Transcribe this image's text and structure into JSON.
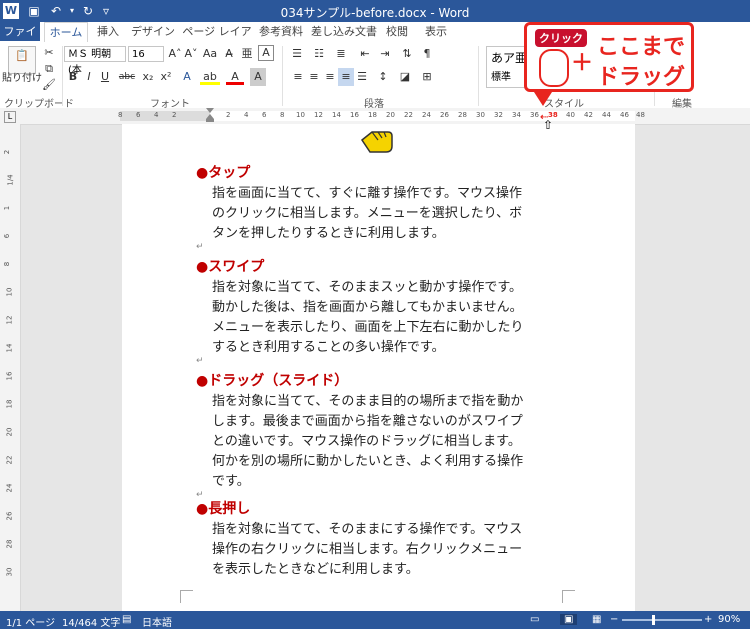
{
  "window": {
    "title": "034サンプル-before.docx - Word"
  },
  "tabs": [
    "ファイル",
    "ホーム",
    "挿入",
    "デザイン",
    "ページ レイアウト",
    "参考資料",
    "差し込み文書",
    "校閲",
    "表示"
  ],
  "ribbon": {
    "paste_label": "貼り付け",
    "font_name": "ＭＳ 明朝 (本",
    "font_size": "16",
    "style_preview": "あア亜",
    "style_name": "標準",
    "groups": {
      "clipboard": "クリップボード",
      "font": "フォント",
      "paragraph": "段落",
      "styles": "スタイル",
      "editing": "編集"
    },
    "format_buttons": [
      "B",
      "I",
      "U",
      "abc",
      "x₂",
      "x²",
      "A",
      "A"
    ]
  },
  "ruler": {
    "ticks": [
      "8",
      "6",
      "4",
      "2",
      "2",
      "4",
      "6",
      "8",
      "10",
      "12",
      "14",
      "16",
      "18",
      "20",
      "22",
      "24",
      "26",
      "28",
      "30",
      "32",
      "34",
      "36",
      "38",
      "40",
      "42",
      "44",
      "46",
      "48"
    ],
    "vticks": [
      "2",
      "1/4",
      "1",
      "6",
      "8",
      "10",
      "12",
      "14",
      "16",
      "18",
      "20",
      "22",
      "24",
      "26",
      "28",
      "30"
    ]
  },
  "document": {
    "sections": [
      {
        "heading": "●タップ",
        "lines": [
          "指を画面に当てて、すぐに離す操作です。マウス操作",
          "のクリックに相当します。メニューを選択したり、ボ",
          "タンを押したりするときに利用します。"
        ]
      },
      {
        "heading": "●スワイプ",
        "lines": [
          "指を対象に当てて、そのままスッと動かす操作です。",
          "動かした後は、指を画面から離してもかまいません。",
          "メニューを表示したり、画面を上下左右に動かしたり",
          "するとき利用することの多い操作です。"
        ]
      },
      {
        "heading": "●ドラッグ（スライド）",
        "lines": [
          "指を対象に当てて、そのまま目的の場所まで指を動か",
          "します。最後まで画面から指を離さないのがスワイプ",
          "との違いです。マウス操作のドラッグに相当します。",
          "何かを別の場所に動かしたいとき、よく利用する操作",
          "です。"
        ]
      },
      {
        "heading": "●長押し",
        "lines": [
          "指を対象に当てて、そのままにする操作です。マウス",
          "操作の右クリックに相当します。右クリックメニュー",
          "を表示したときなどに利用します。"
        ]
      }
    ]
  },
  "callout": {
    "badge": "クリック",
    "plus": "＋",
    "line1": "ここまで",
    "line2": "ドラッグ"
  },
  "status": {
    "page": "1/1 ページ",
    "words": "14/464 文字",
    "language": "日本語",
    "zoom": "90%"
  }
}
